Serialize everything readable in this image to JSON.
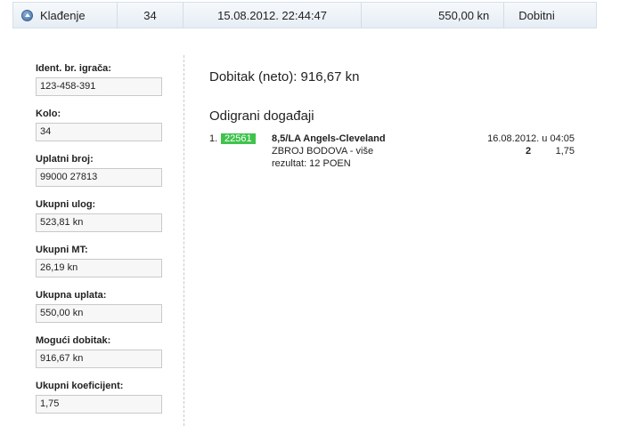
{
  "header": {
    "type": "Klađenje",
    "kolo": "34",
    "datetime": "15.08.2012. 22:44:47",
    "amount": "550,00 kn",
    "status": "Dobitni"
  },
  "form": {
    "fields": [
      {
        "label": "Ident. br. igrača:",
        "value": "123-458-391"
      },
      {
        "label": "Kolo:",
        "value": "34"
      },
      {
        "label": "Uplatni broj:",
        "value": "99000 27813"
      },
      {
        "label": "Ukupni ulog:",
        "value": "523,81 kn"
      },
      {
        "label": "Ukupni MT:",
        "value": "26,19 kn"
      },
      {
        "label": "Ukupna uplata:",
        "value": "550,00 kn"
      },
      {
        "label": "Mogući dobitak:",
        "value": "916,67 kn"
      },
      {
        "label": "Ukupni koeficijent:",
        "value": "1,75"
      }
    ]
  },
  "summary": {
    "dobitak": "Dobitak (neto): 916,67 kn",
    "events_title": "Odigrani događaji"
  },
  "events": [
    {
      "number": "1.",
      "code": "22561",
      "match": "8,5/LA Angels-Cleveland",
      "time": "16.08.2012. u 04:05",
      "market": "ZBROJ BODOVA - više",
      "tip": "2",
      "odd": "1,75",
      "result": "rezultat: 12 POEN"
    }
  ],
  "colors": {
    "code_badge": "#3fc34c",
    "header_border": "#d6dfe8"
  },
  "icons": {
    "collapse": "chevron-up-icon"
  }
}
